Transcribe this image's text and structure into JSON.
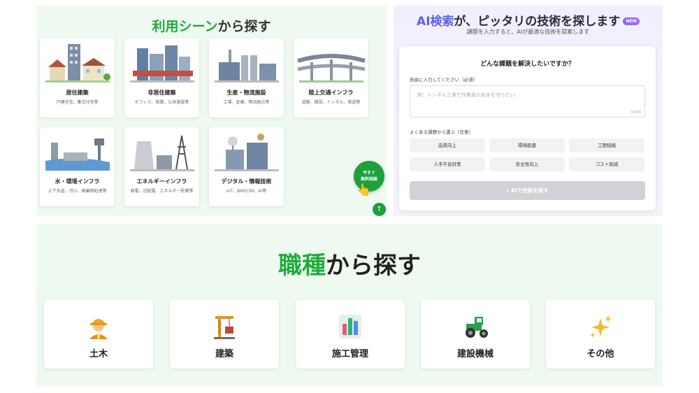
{
  "scene": {
    "title_hl": "利用シーン",
    "title_rest": "から探す",
    "cards": [
      {
        "name": "居住建築",
        "sub": "戸建住宅、集合住宅等"
      },
      {
        "name": "非居住建築",
        "sub": "オフィス、商業、公共施設等"
      },
      {
        "name": "生産・物流施設",
        "sub": "工場、倉庫、物流拠点等"
      },
      {
        "name": "陸上交通インフラ",
        "sub": "道路、橋梁、トンネル、鉄道等"
      },
      {
        "name": "水・環境インフラ",
        "sub": "上下水道、河川、廃棄物処理等"
      },
      {
        "name": "エネルギーインフラ",
        "sub": "発電、送配電、エネルギー貯蔵等"
      },
      {
        "name": "デジタル・情報技術",
        "sub": "IoT、BIM/CIM、AI等"
      }
    ]
  },
  "float": {
    "consult_line1": "今すぐ",
    "consult_line2": "無料相談",
    "top_arrow": "↑",
    "hand": "👆"
  },
  "ai": {
    "head_hl": "AI検索",
    "head_rest": "が、ピッタリの技術を探します",
    "badge": "NEW",
    "sub": "課題を入力すると、AIが最適な技術を提案します",
    "question": "どんな課題を解決したいですか？",
    "input_label": "自由に入力してください（必須）",
    "placeholder": "例：トンネル工事で作業員の安全を守りたい",
    "counter": "0/200",
    "common_label": "よくある課題から選ぶ（任意）",
    "chips": [
      "品質向上",
      "環境配慮",
      "工期短縮",
      "人手不足対策",
      "安全性向上",
      "コスト削減"
    ],
    "submit": "AIで技術を探す"
  },
  "job": {
    "title_hl": "職種",
    "title_rest": "から探す",
    "cards": [
      {
        "label": "土木",
        "icon": "worker-icon"
      },
      {
        "label": "建築",
        "icon": "crane-icon"
      },
      {
        "label": "施工管理",
        "icon": "chart-icon"
      },
      {
        "label": "建設機械",
        "icon": "tractor-icon"
      },
      {
        "label": "その他",
        "icon": "sparkles-icon"
      }
    ]
  },
  "colors": {
    "accent": "#1faa3c",
    "ai_accent": "#5b63d9",
    "panel_bg": "#eefaf0"
  }
}
